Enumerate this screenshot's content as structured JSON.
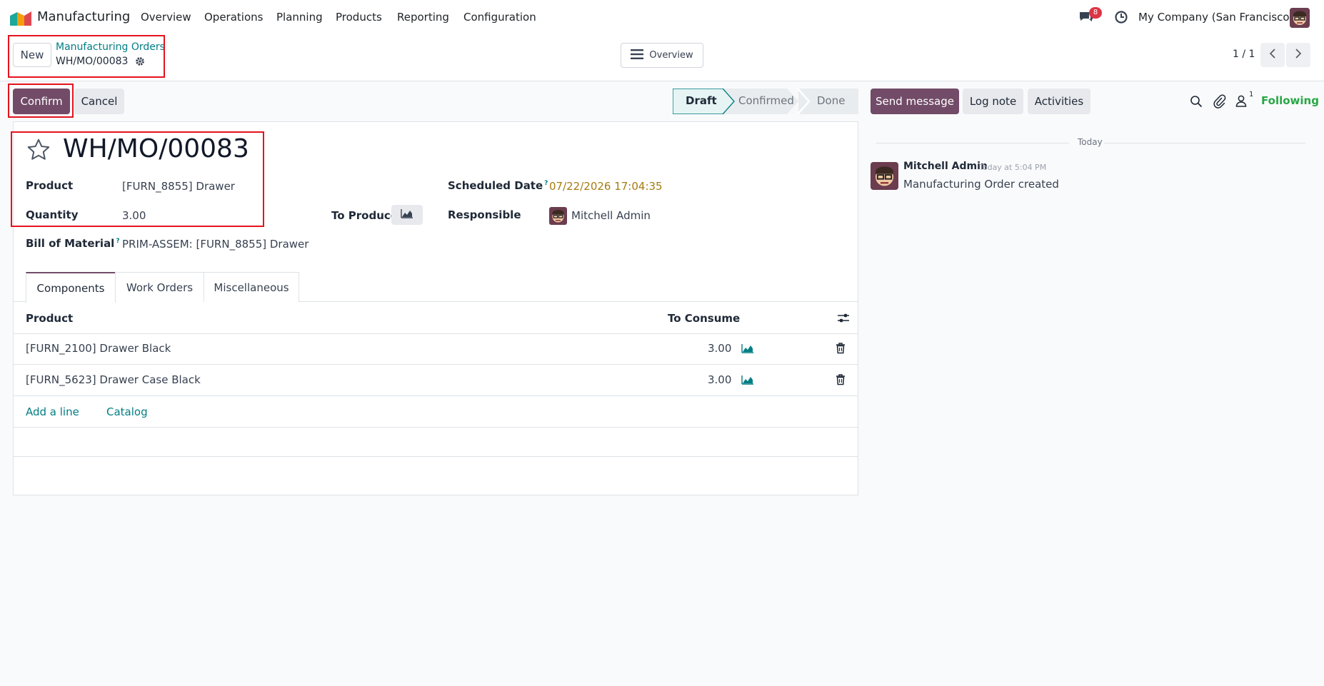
{
  "navbar": {
    "app_name": "Manufacturing",
    "menu": [
      "Overview",
      "Operations",
      "Planning",
      "Products",
      "Reporting",
      "Configuration"
    ],
    "messages_badge": "8",
    "company": "My Company (San Francisco)"
  },
  "control_panel": {
    "new_label": "New",
    "breadcrumb_parent": "Manufacturing Orders",
    "record_name": "WH/MO/00083",
    "overview_label": "Overview",
    "pager": "1 / 1"
  },
  "actions": {
    "confirm_label": "Confirm",
    "cancel_label": "Cancel"
  },
  "status": {
    "stages": [
      "Draft",
      "Confirmed",
      "Done"
    ],
    "current": "Draft"
  },
  "form": {
    "title": "WH/MO/00083",
    "product_label": "Product",
    "product_value": "[FURN_8855] Drawer",
    "quantity_label": "Quantity",
    "quantity_value": "3.00",
    "to_produce_label": "To Produce",
    "bom_label": "Bill of Material",
    "bom_help": "?",
    "bom_value": "PRIM-ASSEM: [FURN_8855] Drawer",
    "scheduled_label": "Scheduled Date",
    "scheduled_help": "?",
    "scheduled_value": "07/22/2026 17:04:35",
    "responsible_label": "Responsible",
    "responsible_value": "Mitchell Admin"
  },
  "tabs": [
    "Components",
    "Work Orders",
    "Miscellaneous"
  ],
  "components": {
    "headers": {
      "product": "Product",
      "to_consume": "To Consume"
    },
    "rows": [
      {
        "product": "[FURN_2100] Drawer Black",
        "qty": "3.00"
      },
      {
        "product": "[FURN_5623] Drawer Case Black",
        "qty": "3.00"
      }
    ],
    "add_line": "Add a line",
    "catalog": "Catalog"
  },
  "chatter": {
    "send_message": "Send message",
    "log_note": "Log note",
    "activities": "Activities",
    "followers_count": "1",
    "following": "Following",
    "date_separator": "Today",
    "message": {
      "author": "Mitchell Admin",
      "time": "Today at 5:04 PM",
      "body": "Manufacturing Order created"
    }
  },
  "colors": {
    "primary": "#714b67",
    "link": "#017e84",
    "highlight_box": "#e5131d",
    "date_warning": "#a67c12",
    "following": "#28a745"
  }
}
